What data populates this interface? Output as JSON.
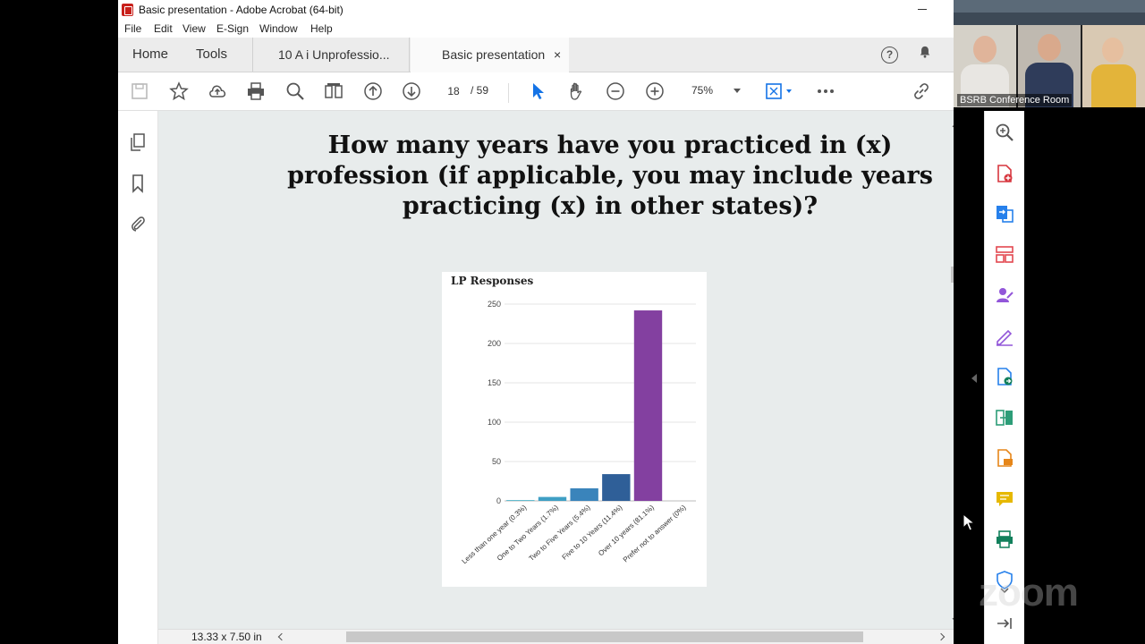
{
  "window": {
    "title": "Basic presentation - Adobe Acrobat (64-bit)"
  },
  "menu": {
    "items": [
      "File",
      "Edit",
      "View",
      "E-Sign",
      "Window",
      "Help"
    ]
  },
  "tabs": {
    "home": "Home",
    "tools": "Tools",
    "doc1": "10 A i Unprofessio...",
    "doc2": "Basic presentation",
    "close_glyph": "×"
  },
  "toolbar": {
    "current_page": "18",
    "total_pages": "/  59",
    "zoom": "75%",
    "icons": [
      "save-icon",
      "star-icon",
      "cloud-upload-icon",
      "print-icon",
      "search-zoom-icon",
      "compare-icon",
      "page-up-icon",
      "page-down-icon",
      "select-arrow-icon",
      "hand-icon",
      "zoom-out-icon",
      "zoom-in-icon",
      "fit-page-icon",
      "more-icon",
      "link-icon"
    ]
  },
  "slide": {
    "title": "How many years have you practiced in (x) profession (if applicable, you may include years practicing (x) in other states)?"
  },
  "chart_data": {
    "type": "bar",
    "title": "LP Responses",
    "categories": [
      "Less than one year (0.3%)",
      "One to Two Years (1.7%)",
      "Two to Five Years (5.4%)",
      "Five to 10 Years (11.4%)",
      "Over 10 years (81.1%)",
      "Prefer not to answer (0%)"
    ],
    "values": [
      1,
      5,
      16,
      34,
      242,
      0
    ],
    "colors": [
      "#4fb3c8",
      "#3f9fc4",
      "#3a84bb",
      "#2f5f98",
      "#8340a0",
      "#8340a0"
    ],
    "ylim": [
      0,
      250
    ],
    "yticks": [
      "250",
      "200",
      "150",
      "100",
      "50",
      "0"
    ],
    "grid": true
  },
  "status": {
    "page_size": "13.33 x 7.50 in"
  },
  "video": {
    "room_label": "BSRB Conference Room"
  },
  "watermark": "zoom",
  "colors": {
    "acrobat_red": "#c8201b",
    "select_blue": "#1473e6",
    "bar_purple": "#8340a0"
  }
}
